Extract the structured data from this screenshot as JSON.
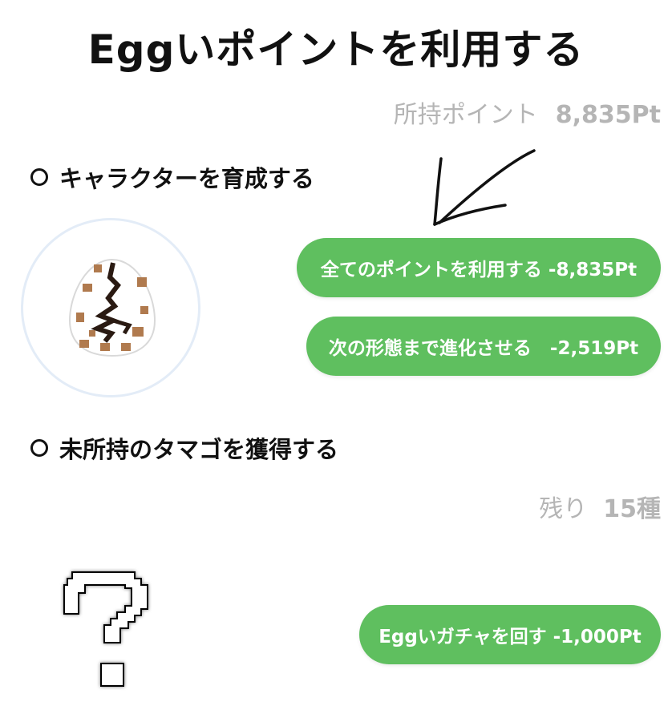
{
  "page": {
    "title": "Eggいポイントを利用する"
  },
  "points": {
    "label": "所持ポイント",
    "value": "8,835Pt"
  },
  "sections": {
    "raise": {
      "heading": "キャラクターを育成する",
      "character_icon": "spotted-egg-icon",
      "buttons": {
        "use_all": "全てのポイントを利用する -8,835Pt",
        "evolve": "次の形態まで進化させる　-2,519Pt"
      }
    },
    "acquire": {
      "heading": "未所持のタマゴを獲得する",
      "remaining_label": "残り",
      "remaining_value": "15種",
      "unknown_icon": "question-mark-icon",
      "buttons": {
        "gacha": "Eggいガチャを回す -1,000Pt"
      }
    }
  },
  "colors": {
    "accent_green": "#5fbf5f",
    "muted_text": "#b5b5b5",
    "circle_border": "#e3ecf7",
    "egg_spot": "#b07a4e"
  }
}
